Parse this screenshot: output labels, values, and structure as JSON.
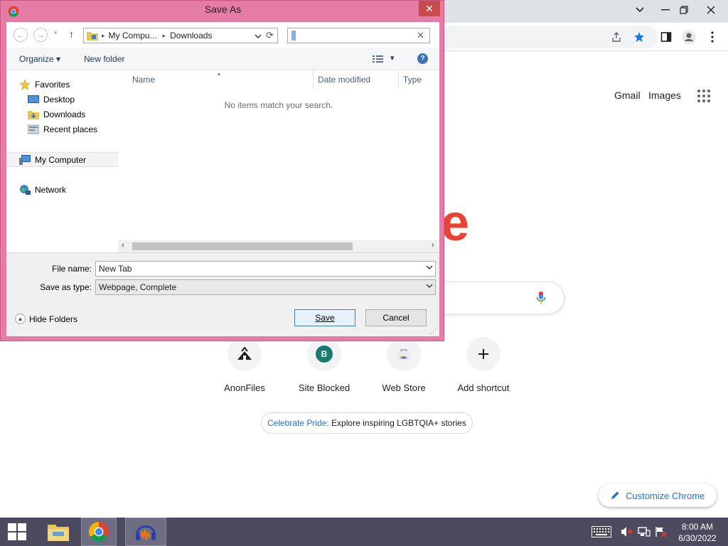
{
  "dialog": {
    "title": "Save As",
    "close_glyph": "✕",
    "nav": {
      "back": "←",
      "forward": "→",
      "up": "↑",
      "recent": "▾"
    },
    "address": {
      "segments": [
        "My Compu...",
        "Downloads"
      ],
      "separator": "▸"
    },
    "search": {
      "value": ""
    },
    "toolbar": {
      "organize": "Organize ▾",
      "new_folder": "New folder",
      "view": "▾",
      "help": "?"
    },
    "tree": {
      "favorites": "Favorites",
      "desktop": "Desktop",
      "downloads": "Downloads",
      "recent_places": "Recent places",
      "my_computer": "My Computer",
      "network": "Network"
    },
    "columns": {
      "name": "Name",
      "date_modified": "Date modified",
      "type": "Type"
    },
    "empty_message": "No items match your search.",
    "file_name_label": "File name:",
    "file_name_value": "New Tab",
    "save_type_label": "Save as type:",
    "save_type_value": "Webpage, Complete",
    "hide_folders": "Hide Folders",
    "save_button": "Save",
    "cancel_button": "Cancel"
  },
  "chrome": {
    "header_links": {
      "gmail": "Gmail",
      "images": "Images"
    },
    "logo_fragment": "e",
    "shortcuts": [
      {
        "label": "AnonFiles",
        "icon": "anonfiles-icon"
      },
      {
        "label": "Site Blocked",
        "icon": "letter-b-icon",
        "letter": "B"
      },
      {
        "label": "Web Store",
        "icon": "web-store-icon"
      },
      {
        "label": "Add shortcut",
        "icon": "plus-icon"
      }
    ],
    "pride": {
      "link": "Celebrate Pride:",
      "text": " Explore inspiring LGBTQIA+ stories"
    },
    "customize": "Customize Chrome"
  },
  "taskbar": {
    "time": "8:00 AM",
    "date": "6/30/2022"
  },
  "colors": {
    "dialog_frame": "#e57ca5",
    "accent": "#1a73e8",
    "taskbar": "#4c4a5e"
  }
}
